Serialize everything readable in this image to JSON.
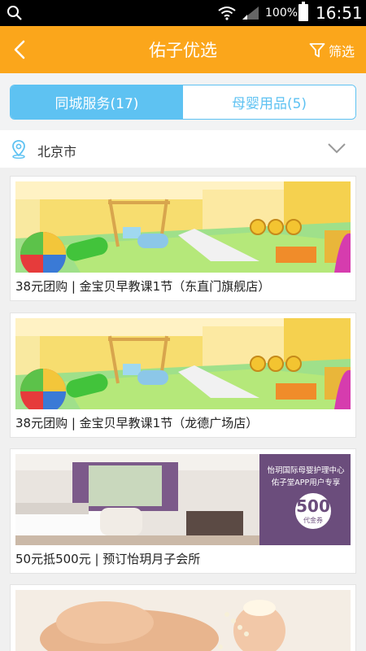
{
  "status_bar": {
    "battery_percent": "100%",
    "time": "16:51"
  },
  "header": {
    "title": "佑子优选",
    "filter_label": "筛选"
  },
  "tabs": [
    {
      "label": "同城服务(17)",
      "active": true
    },
    {
      "label": "母婴用品(5)",
      "active": false
    }
  ],
  "location": {
    "city": "北京市"
  },
  "items": [
    {
      "caption": "38元团购 | 金宝贝早教课1节（东直门旗舰店）"
    },
    {
      "caption": "38元团购 | 金宝贝早教课1节（龙德广场店）"
    },
    {
      "caption": "50元抵500元 | 预订怡玥月子会所",
      "promo_line1": "怡玥国际母婴护理中心",
      "promo_line2": "佑子堂APP用户专享",
      "voucher_amount": "500",
      "voucher_label": "代金券"
    },
    {
      "caption": ""
    }
  ],
  "colors": {
    "header": "#fba61b",
    "tab_accent": "#5ec2f2",
    "promo_bg": "#6b4d7c"
  }
}
